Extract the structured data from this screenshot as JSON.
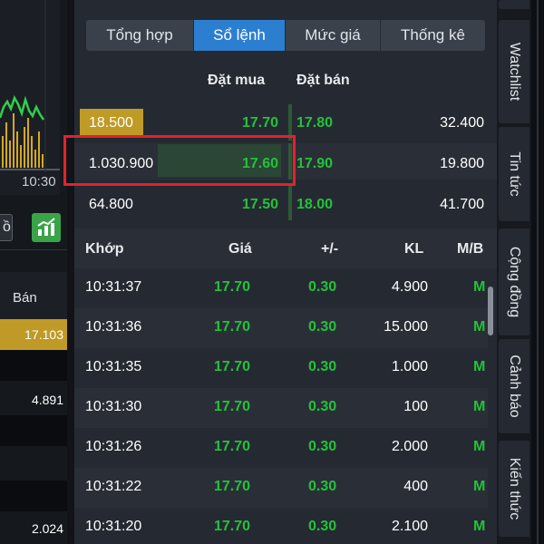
{
  "left_panel": {
    "time_tick": "10:30",
    "partial_button_label": "ồ",
    "chart_button_icon": "bar-chart-up-icon",
    "column_header": "Bán",
    "rows": [
      {
        "value": "17.103"
      },
      {
        "value": ""
      },
      {
        "value": "4.891"
      },
      {
        "value": ""
      },
      {
        "value": ""
      },
      {
        "value": ""
      },
      {
        "value": "2.024"
      }
    ]
  },
  "tabs": [
    "Tổng hợp",
    "Sổ lệnh",
    "Mức giá",
    "Thống kê"
  ],
  "active_tab": "Sổ lệnh",
  "order_book": {
    "bid_header": "Đặt mua",
    "ask_header": "Đặt bán",
    "rows": [
      {
        "bid_vol": "18.500",
        "bid_price": "17.70",
        "ask_price": "17.80",
        "ask_vol": "32.400"
      },
      {
        "bid_vol": "1.030.900",
        "bid_price": "17.60",
        "ask_price": "17.90",
        "ask_vol": "19.800"
      },
      {
        "bid_vol": "64.800",
        "bid_price": "17.50",
        "ask_price": "18.00",
        "ask_vol": "41.700"
      }
    ]
  },
  "matched_trades": {
    "headers": {
      "time": "Khớp",
      "price": "Giá",
      "change": "+/-",
      "volume": "KL",
      "side": "M/B"
    },
    "rows": [
      {
        "time": "10:31:37",
        "price": "17.70",
        "change": "0.30",
        "volume": "4.900",
        "side": "M"
      },
      {
        "time": "10:31:36",
        "price": "17.70",
        "change": "0.30",
        "volume": "15.000",
        "side": "M"
      },
      {
        "time": "10:31:35",
        "price": "17.70",
        "change": "0.30",
        "volume": "1.000",
        "side": "M"
      },
      {
        "time": "10:31:30",
        "price": "17.70",
        "change": "0.30",
        "volume": "100",
        "side": "M"
      },
      {
        "time": "10:31:26",
        "price": "17.70",
        "change": "0.30",
        "volume": "2.000",
        "side": "M"
      },
      {
        "time": "10:31:22",
        "price": "17.70",
        "change": "0.30",
        "volume": "400",
        "side": "M"
      },
      {
        "time": "10:31:20",
        "price": "17.70",
        "change": "0.30",
        "volume": "2.100",
        "side": "M"
      }
    ]
  },
  "side_tabs": [
    "Watchlist",
    "Tin tức",
    "Cộng đồng",
    "Cảnh báo",
    "Kiến thức"
  ],
  "colors": {
    "up": "#23c23a",
    "active_tab": "#2c7fd0",
    "highlight": "#e2222b",
    "gold": "#c09a26"
  }
}
